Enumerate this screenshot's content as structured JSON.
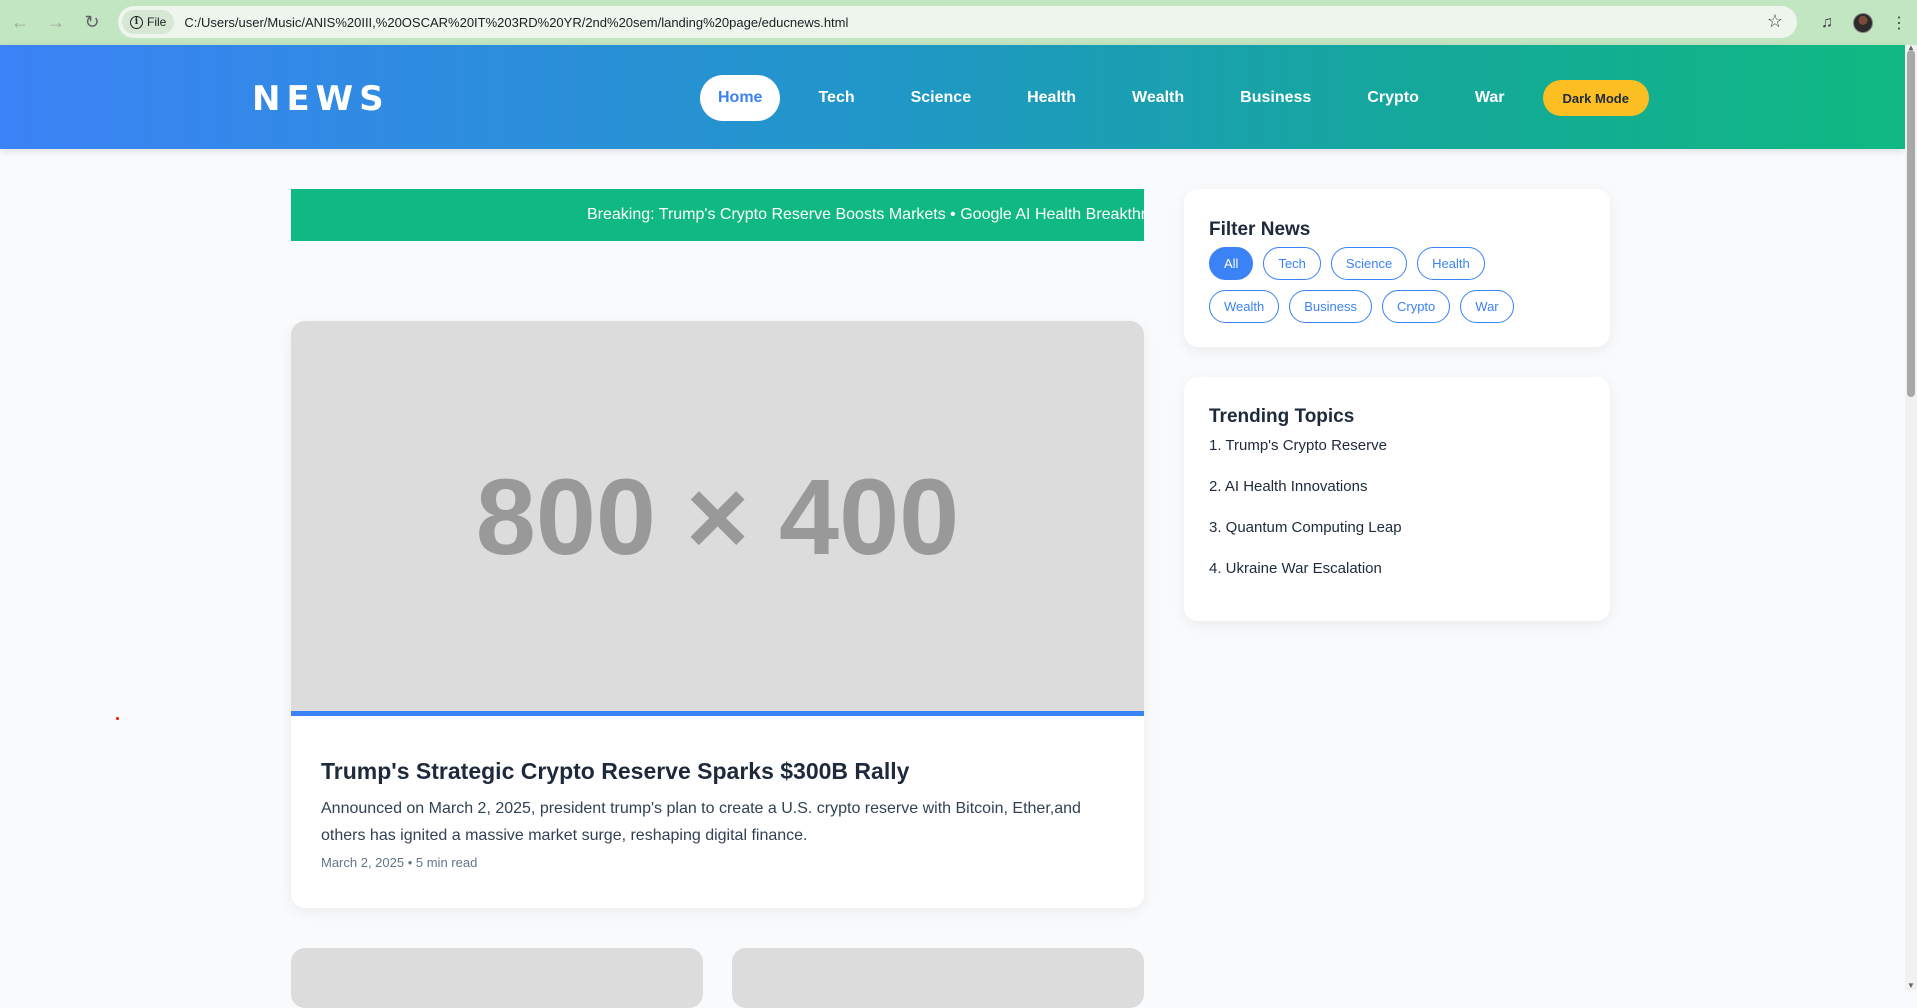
{
  "browser": {
    "file_label": "File",
    "url": "C:/Users/user/Music/ANIS%20III,%20OSCAR%20IT%203RD%20YR/2nd%20sem/landing%20page/educnews.html"
  },
  "header": {
    "logo": "NEWS",
    "nav": [
      "Home",
      "Tech",
      "Science",
      "Health",
      "Wealth",
      "Business",
      "Crypto",
      "War"
    ],
    "dark_mode_label": "Dark Mode"
  },
  "breaking": {
    "text": "Breaking: Trump's Crypto Reserve Boosts Markets • Google AI Health Breakthrough"
  },
  "feature": {
    "image_placeholder": "800 × 400",
    "title": "Trump's Strategic Crypto Reserve Sparks $300B Rally",
    "description": "Announced on March 2, 2025, president trump's plan to create a U.S. crypto reserve with Bitcoin, Ether,and others has ignited a massive market surge, reshaping digital finance.",
    "meta": "March 2, 2025 • 5 min read"
  },
  "filter": {
    "title": "Filter News",
    "chips": [
      "All",
      "Tech",
      "Science",
      "Health",
      "Wealth",
      "Business",
      "Crypto",
      "War"
    ]
  },
  "trending": {
    "title": "Trending Topics",
    "items": [
      "1. Trump's Crypto Reserve",
      "2. AI Health Innovations",
      "3. Quantum Computing Leap",
      "4. Ukraine War Escalation"
    ]
  },
  "colors": {
    "primary": "#3b82f6",
    "accent_green": "#10b981",
    "dark_mode_button": "#fbbf24"
  }
}
